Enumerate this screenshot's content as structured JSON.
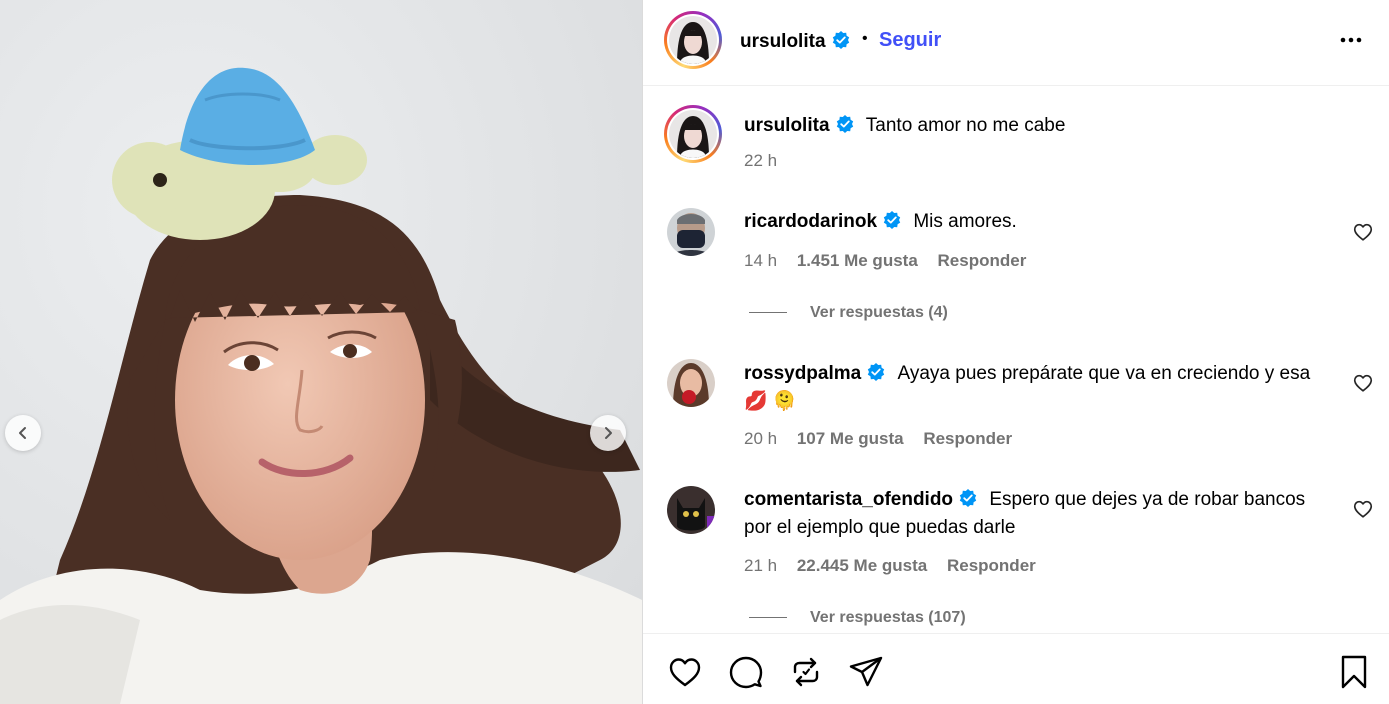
{
  "post": {
    "username": "ursulolita",
    "follow_label": "Seguir",
    "separator": "•",
    "caption": "Tanto amor no me cabe",
    "caption_time": "22 h"
  },
  "comments": [
    {
      "username": "ricardodarinok",
      "text": "Mis amores.",
      "time": "14 h",
      "likes": "1.451 Me gusta",
      "reply": "Responder",
      "view_replies": "Ver respuestas (4)"
    },
    {
      "username": "rossydpalma",
      "text": "Ayaya pues prepárate que va en creciendo y esa 💋 🫠",
      "time": "20 h",
      "likes": "107 Me gusta",
      "reply": "Responder"
    },
    {
      "username": "comentarista_ofendido",
      "text": "Espero que dejes ya de robar bancos por el ejemplo que puedas darle",
      "time": "21 h",
      "likes": "22.445 Me gusta",
      "reply": "Responder",
      "view_replies": "Ver respuestas (107)"
    }
  ],
  "icons": {
    "verified": "verified-badge-icon",
    "more": "more-options-icon",
    "like": "heart-icon",
    "comment": "comment-icon",
    "repost": "repost-icon",
    "share": "share-icon",
    "save": "bookmark-icon",
    "prev": "chevron-left-icon",
    "next": "chevron-right-icon"
  },
  "colors": {
    "follow": "#4150f7",
    "verified": "#0095f6",
    "muted": "#737373",
    "hat": "#5aaee4",
    "turtle": "#dfe3b8"
  }
}
